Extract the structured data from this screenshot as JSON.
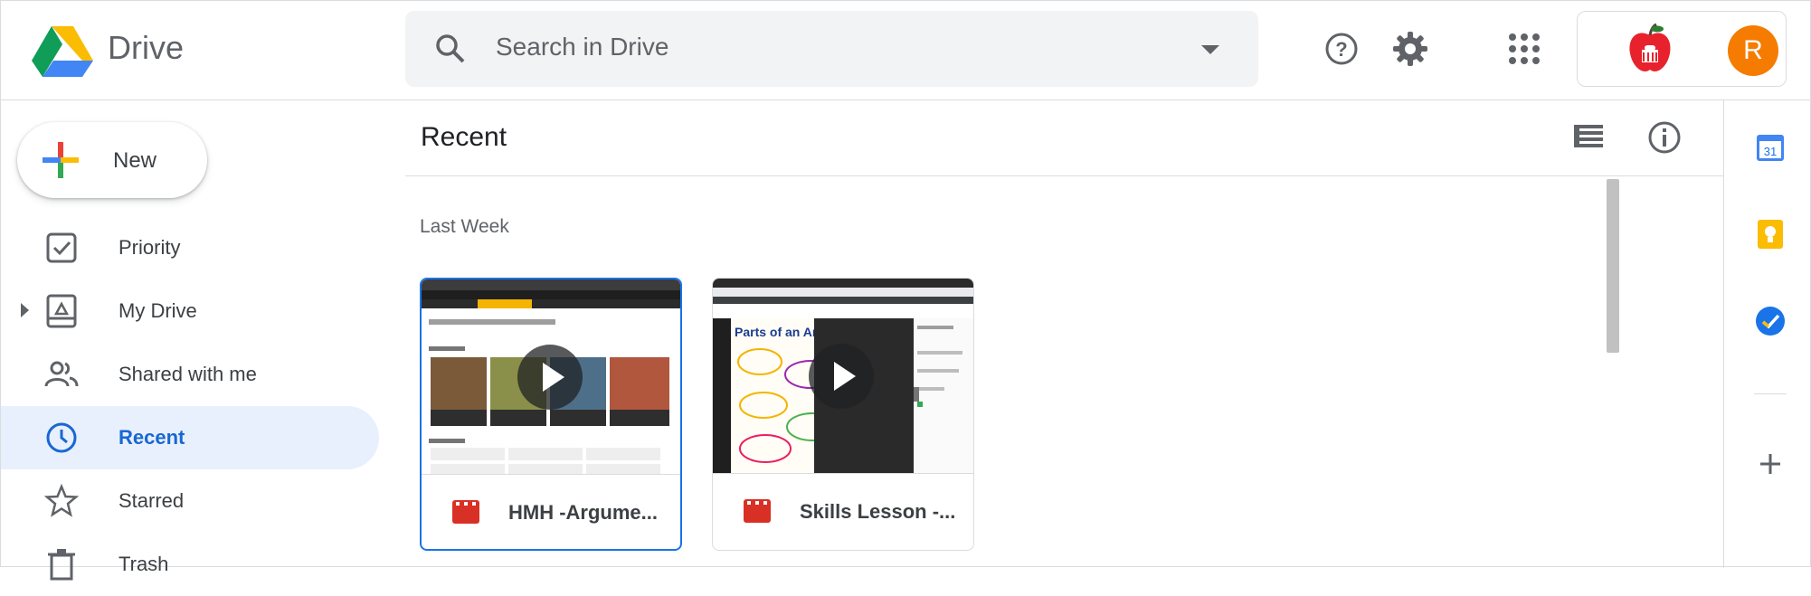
{
  "app": {
    "name": "Drive"
  },
  "search": {
    "placeholder": "Search in Drive"
  },
  "account": {
    "avatar_initial": "R"
  },
  "new_button": {
    "label": "New"
  },
  "sidebar": {
    "items": [
      {
        "label": "Priority",
        "icon": "priority-icon"
      },
      {
        "label": "My Drive",
        "icon": "my-drive-icon"
      },
      {
        "label": "Shared with me",
        "icon": "people-icon"
      },
      {
        "label": "Recent",
        "icon": "clock-icon",
        "active": true
      },
      {
        "label": "Starred",
        "icon": "star-icon"
      },
      {
        "label": "Trash",
        "icon": "trash-icon"
      }
    ]
  },
  "main": {
    "title": "Recent",
    "section": "Last Week",
    "files": [
      {
        "name": "HMH -Argume...",
        "type": "video",
        "selected": true
      },
      {
        "name": "Skills Lesson -...",
        "type": "video",
        "selected": false
      }
    ]
  },
  "colors": {
    "accent": "#1a73e8",
    "active_bg": "#e8f0fe",
    "avatar": "#f57c00",
    "video_icon": "#d93025"
  }
}
